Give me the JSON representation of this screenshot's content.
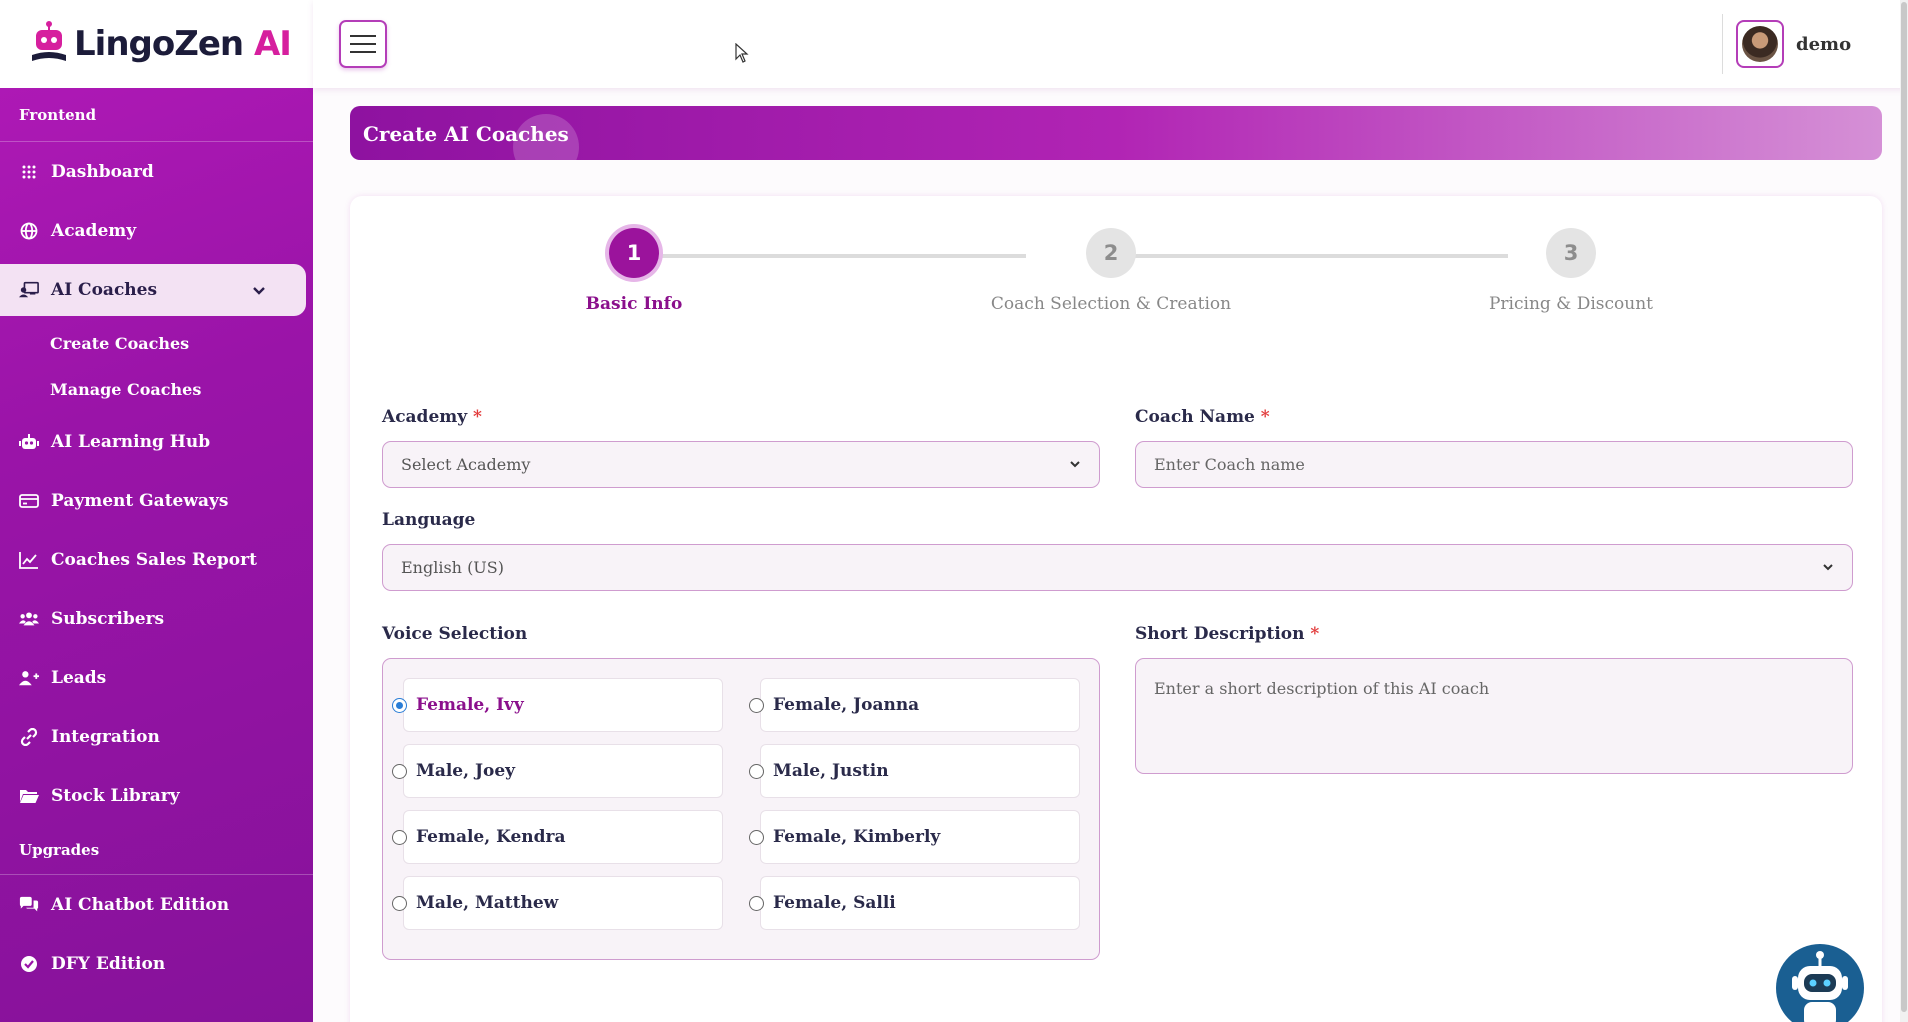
{
  "brand": {
    "name_main": "LingoZen",
    "name_ai": "AI"
  },
  "header": {
    "username": "demo"
  },
  "sidebar": {
    "section_frontend": "Frontend",
    "items": [
      {
        "label": "Dashboard",
        "icon": "grid-icon"
      },
      {
        "label": "Academy",
        "icon": "globe-icon"
      },
      {
        "label": "AI Coaches",
        "icon": "coach-icon",
        "active": true
      },
      {
        "label": "AI Learning Hub",
        "icon": "robot-icon"
      },
      {
        "label": "Payment Gateways",
        "icon": "card-icon"
      },
      {
        "label": "Coaches Sales Report",
        "icon": "chart-icon"
      },
      {
        "label": "Subscribers",
        "icon": "users-icon"
      },
      {
        "label": "Leads",
        "icon": "user-plus-icon"
      },
      {
        "label": "Integration",
        "icon": "link-icon"
      },
      {
        "label": "Stock Library",
        "icon": "folder-icon"
      }
    ],
    "subitems": [
      "Create Coaches",
      "Manage Coaches"
    ],
    "section_upgrades": "Upgrades",
    "upgrades": [
      {
        "label": "AI Chatbot Edition",
        "icon": "chat-icon"
      },
      {
        "label": "DFY Edition",
        "icon": "check-circle-icon"
      }
    ]
  },
  "page": {
    "title": "Create AI Coaches"
  },
  "steps": [
    {
      "number": "1",
      "label": "Basic Info",
      "active": true
    },
    {
      "number": "2",
      "label": "Coach Selection & Creation",
      "active": false
    },
    {
      "number": "3",
      "label": "Pricing & Discount",
      "active": false
    }
  ],
  "form": {
    "academy_label": "Academy",
    "academy_value": "Select Academy",
    "coach_name_label": "Coach Name",
    "coach_name_placeholder": "Enter Coach name",
    "language_label": "Language",
    "language_value": "English (US)",
    "voice_label": "Voice Selection",
    "voices": [
      "Female, Ivy",
      "Female, Joanna",
      "Male, Joey",
      "Male, Justin",
      "Female, Kendra",
      "Female, Kimberly",
      "Male, Matthew",
      "Female, Salli"
    ],
    "selected_voice": "Female, Ivy",
    "short_desc_label": "Short Description",
    "short_desc_placeholder": "Enter a short description of this AI coach",
    "required_mark": "*"
  },
  "colors": {
    "accent": "#9b139c",
    "sidebar": "#a817b0",
    "required": "#e23b3b"
  }
}
